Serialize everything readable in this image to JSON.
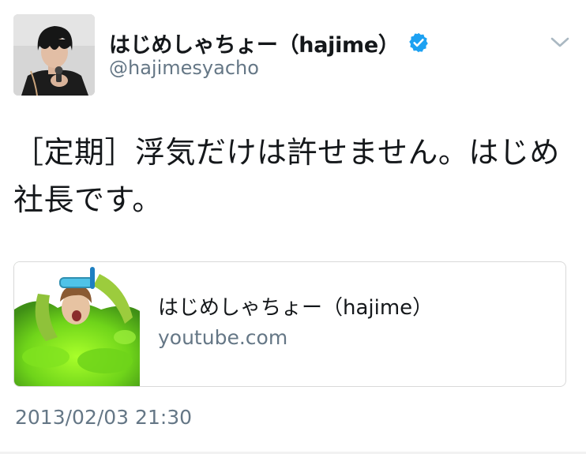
{
  "author": {
    "display_name": "はじめしゃちょー（hajime）",
    "handle": "@hajimesyacho",
    "verified": true,
    "avatar_icon": "profile-photo",
    "verified_icon": "verified-badge-icon",
    "verified_color": "#1da1f2"
  },
  "tweet": {
    "text": "［定期］浮気だけは許せません。はじめ社長です。",
    "timestamp": "2013/02/03 21:30"
  },
  "card": {
    "title": "はじめしゃちょー（hajime）",
    "domain": "youtube.com",
    "thumbnail_icon": "video-thumbnail"
  },
  "menu": {
    "caret_icon": "chevron-down-icon"
  },
  "colors": {
    "text_primary": "#14171a",
    "text_secondary": "#657786",
    "border": "#d9d9d9"
  }
}
